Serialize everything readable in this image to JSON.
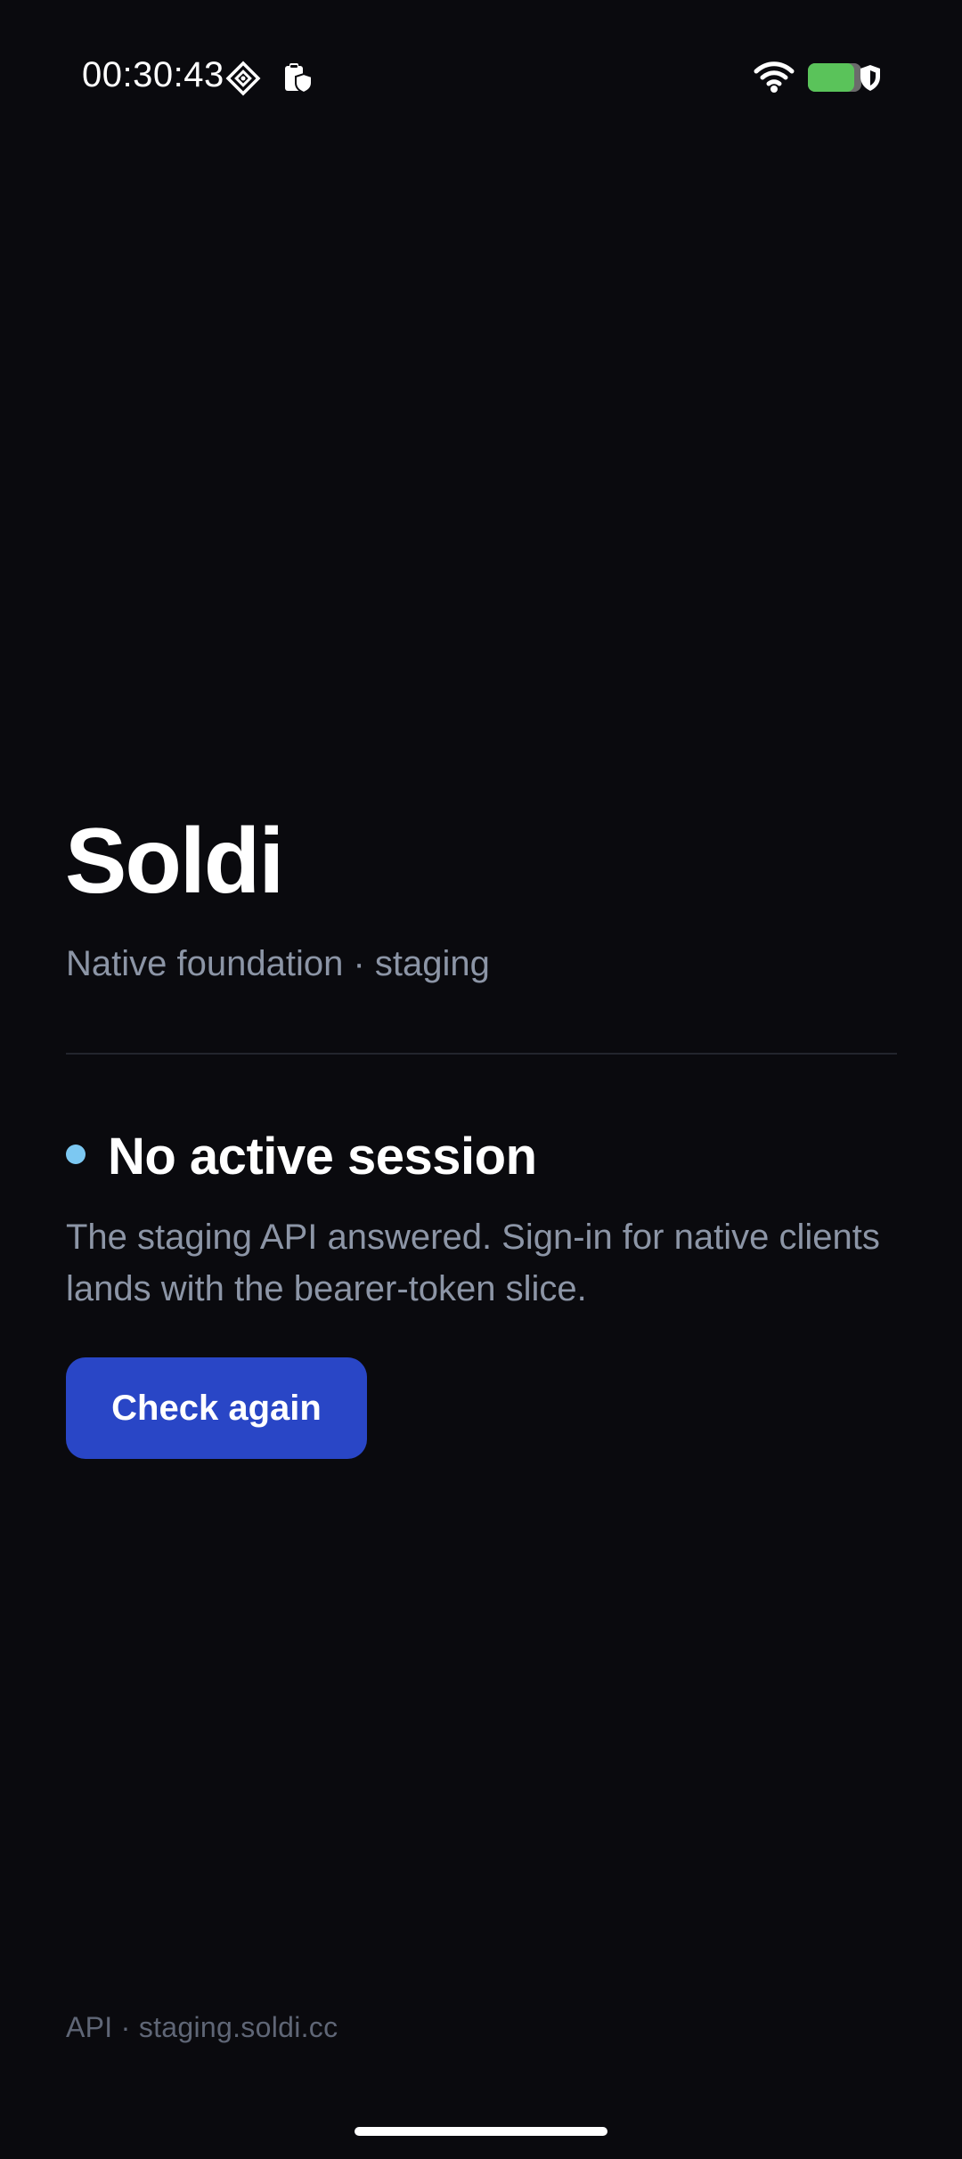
{
  "status_bar": {
    "time": "00:30:43",
    "icons": [
      "puzzle-diamond-icon",
      "clipboard-shield-icon",
      "wifi-icon",
      "battery-icon",
      "shield-icon"
    ],
    "battery_color": "#5ac35a"
  },
  "app": {
    "title": "Soldi",
    "subtitle": "Native foundation · staging"
  },
  "session": {
    "status_dot_color": "#7cc8f2",
    "heading": "No active session",
    "message": "The staging API answered. Sign-in for native clients lands with the bearer-token slice.",
    "button_label": "Check again",
    "button_color": "#2946c6"
  },
  "footer": {
    "api_label": "API · staging.soldi.cc"
  }
}
